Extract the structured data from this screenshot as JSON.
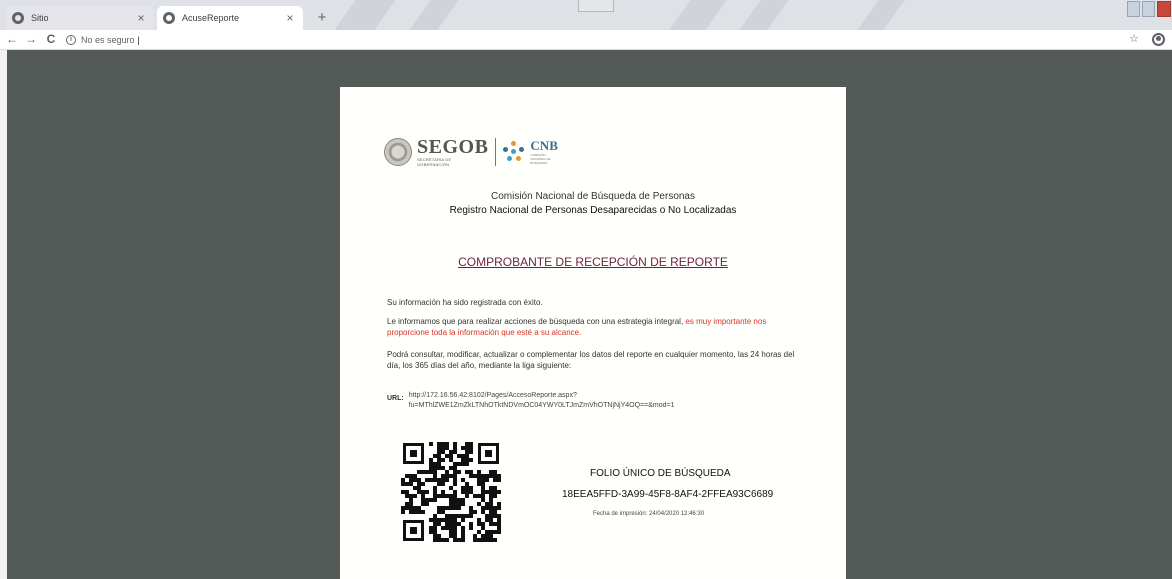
{
  "browser": {
    "tabs": [
      {
        "title": "Sitio",
        "close": "×"
      },
      {
        "title": "AcuseReporte",
        "close": "×"
      }
    ],
    "new_tab": "+",
    "nav": {
      "back": "←",
      "forward": "→",
      "reload": "C"
    },
    "address": {
      "security_icon": "i",
      "security_text": "No es seguro",
      "caret": "|"
    },
    "bookmark": "☆"
  },
  "document": {
    "logo": {
      "segob_name": "SEGOB",
      "segob_sub": "SECRETARÍA DE GOBERNACIÓN",
      "cnb_name": "CNB",
      "cnb_sub": "COMISIÓN NACIONAL DE BÚSQUEDA"
    },
    "commission": "Comisión Nacional de Búsqueda de Personas",
    "registry": "Registro Nacional de Personas Desaparecidas o No Localizadas",
    "heading": "COMPROBANTE DE RECEPCIÓN DE REPORTE",
    "paragraph_1": "Su información ha sido registrada con éxito.",
    "paragraph_2_a": "Le informamos que para realizar acciones de búsqueda con una estrategia integral, ",
    "paragraph_2_b": "es muy importante nos proporcione toda la información que esté a su alcance.",
    "paragraph_3": "Podrá consultar, modificar, actualizar o complementar los datos del reporte en cualquier momento, las 24 horas del día, los 365 días del año, mediante la liga siguiente:",
    "url_label": "URL:",
    "url_line_1": "http://172.16.56.42:8102/Pages/AccesoReporte.aspx?",
    "url_line_2": "fu=MThlZWE1ZmZkLTNhOTktNDVmOC04YWY0LTJmZmVhOTNjNjY4OQ==&mod=1",
    "folio_label": "FOLIO ÚNICO DE BÚSQUEDA",
    "folio_value": "18EEA5FFD-3A99-45F8-8AF4-2FFEA93C6689",
    "print_date": "Fecha de impresión: 24/04/2020 12:46:30"
  },
  "colors": {
    "viewer_bg": "#535957",
    "heading": "#6b1f45",
    "highlight": "#d9332b",
    "cnb_blue": "#3a6e94"
  }
}
